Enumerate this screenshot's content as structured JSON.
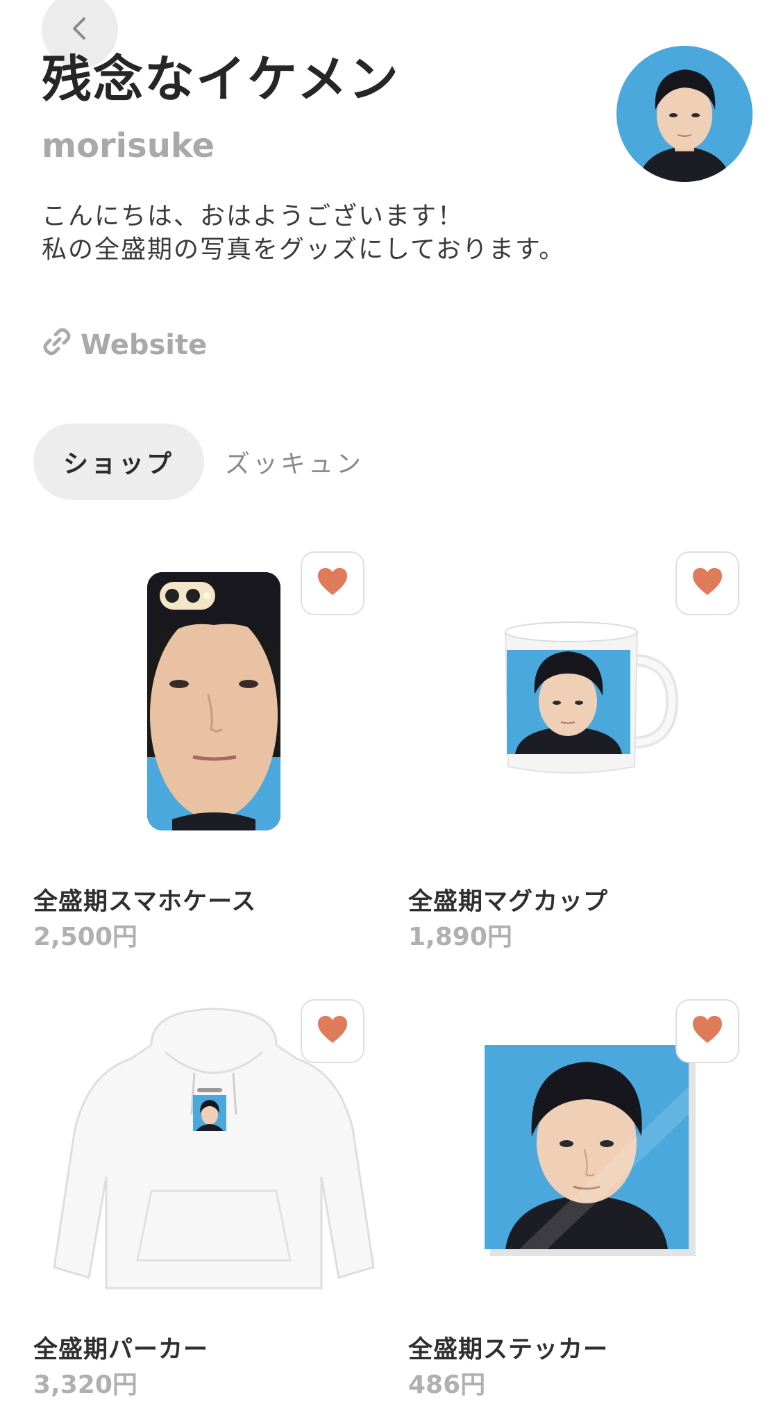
{
  "header": {
    "shop_title": "残念なイケメン",
    "username": "morisuke",
    "bio_lines": [
      "こんにちは、おはようございます！",
      "私の全盛期の写真をグッズにしております。"
    ],
    "website_label": "Website"
  },
  "tabs": [
    {
      "label": "ショップ",
      "active": true
    },
    {
      "label": "ズッキュン",
      "active": false
    }
  ],
  "products": [
    {
      "name": "全盛期スマホケース",
      "price": "2,500円"
    },
    {
      "name": "全盛期マグカップ",
      "price": "1,890円"
    },
    {
      "name": "全盛期パーカー",
      "price": "3,320円"
    },
    {
      "name": "全盛期ステッカー",
      "price": "486円"
    }
  ],
  "colors": {
    "heart": "#e07b5a",
    "tab_active_bg": "#ededed",
    "muted_text": "#a9a9a9",
    "photo_bg": "#5ab4e0"
  },
  "icons": {
    "back": "chevron-left-icon",
    "link": "link-icon",
    "favorite": "heart-icon"
  }
}
